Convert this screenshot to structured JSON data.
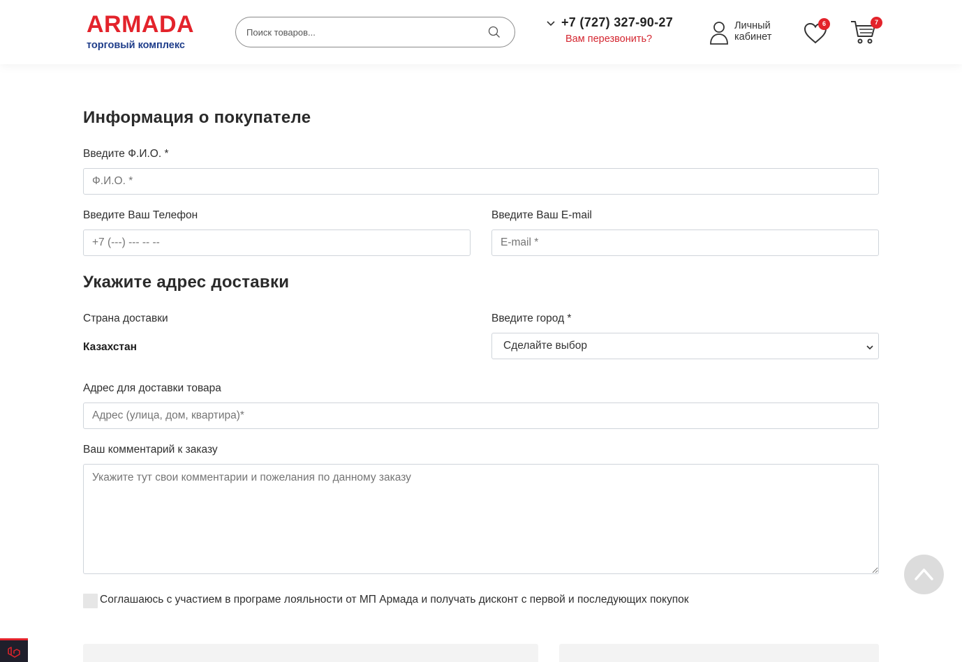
{
  "colors": {
    "brand_red": "#e3232b",
    "brand_blue": "#1e3d8a",
    "callback_red": "#d42630",
    "border": "#cfd4da"
  },
  "header": {
    "logo": {
      "word": "ARMADA",
      "subtitle": "торговый комплекс"
    },
    "search": {
      "placeholder": "Поиск товаров...",
      "icon": "search-icon"
    },
    "phone": {
      "number": "+7 (727) 327-90-27",
      "callback": "Вам перезвонить?"
    },
    "account": {
      "label": "Личный кабинет",
      "icon": "user-icon"
    },
    "favorites": {
      "count": "6",
      "icon": "heart-icon"
    },
    "cart": {
      "count": "7",
      "icon": "cart-icon"
    }
  },
  "buyer": {
    "title": "Информация о покупателе",
    "name": {
      "label": "Введите Ф.И.О. *",
      "placeholder": "Ф.И.О. *"
    },
    "phone": {
      "label": "Введите Ваш Телефон",
      "placeholder": "+7 (---) --- -- --"
    },
    "email": {
      "label": "Введите Ваш E-mail",
      "placeholder": "E-mail *"
    }
  },
  "delivery": {
    "title": "Укажите адрес доставки",
    "country": {
      "label": "Страна доставки",
      "value": "Казахстан"
    },
    "city": {
      "label": "Введите город *",
      "selected": "Сделайте выбор"
    },
    "address": {
      "label": "Адрес для доставки товара",
      "placeholder": "Адрес (улица, дом, квартира)*"
    },
    "comment": {
      "label": "Ваш комментарий к заказу",
      "placeholder": "Укажите тут свои комментарии и пожелания по данному заказу"
    }
  },
  "loyalty": {
    "label": "Соглашаюсь с участием в програме лояльности от МП Армада и получать дисконт с первой и последующих покупок",
    "checked": false
  }
}
